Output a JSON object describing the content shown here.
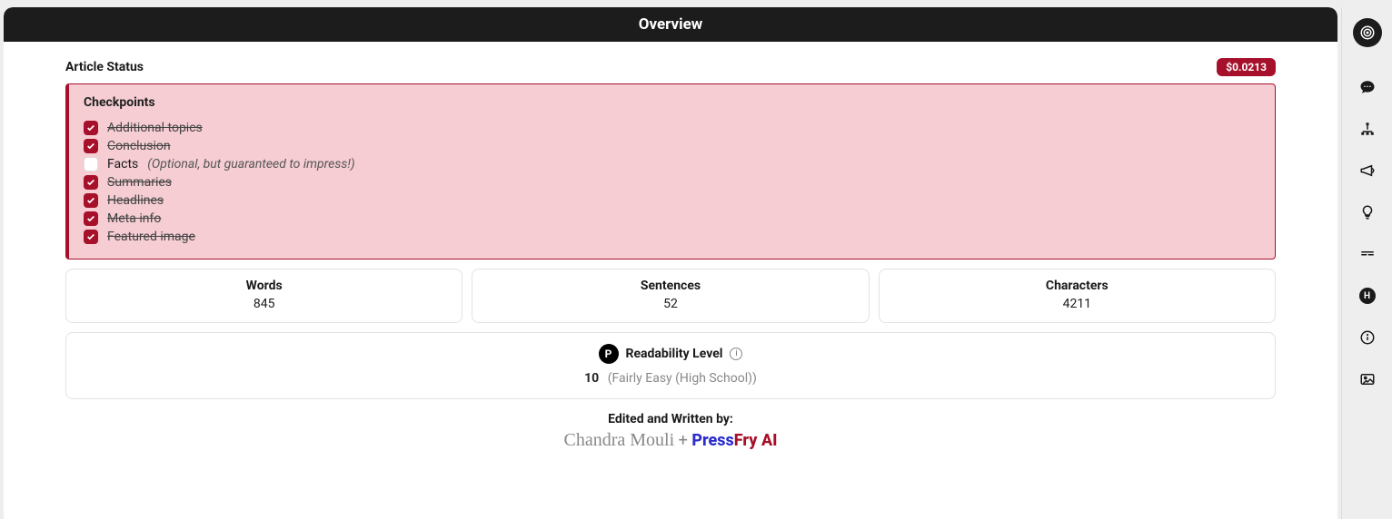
{
  "header": {
    "title": "Overview"
  },
  "status": {
    "title": "Article Status",
    "price": "$0.0213"
  },
  "checkpoints": {
    "title": "Checkpoints",
    "items": [
      {
        "label": "Additional topics",
        "checked": true,
        "note": ""
      },
      {
        "label": "Conclusion",
        "checked": true,
        "note": ""
      },
      {
        "label": "Facts",
        "checked": false,
        "note": "(Optional, but guaranteed to impress!)"
      },
      {
        "label": "Summaries",
        "checked": true,
        "note": ""
      },
      {
        "label": "Headlines",
        "checked": true,
        "note": ""
      },
      {
        "label": "Meta info",
        "checked": true,
        "note": ""
      },
      {
        "label": "Featured image",
        "checked": true,
        "note": ""
      }
    ]
  },
  "stats": {
    "words": {
      "label": "Words",
      "value": "845"
    },
    "sentences": {
      "label": "Sentences",
      "value": "52"
    },
    "characters": {
      "label": "Characters",
      "value": "4211"
    }
  },
  "readability": {
    "label": "Readability Level",
    "badge": "P",
    "score": "10",
    "desc": "(Fairly Easy (High School))"
  },
  "credits": {
    "label": "Edited and Written by:",
    "author": "Chandra Mouli",
    "plus": "+",
    "brand1": "Press",
    "brand2": "Fry",
    "brand3": " AI"
  },
  "rail": {
    "h": "H"
  }
}
